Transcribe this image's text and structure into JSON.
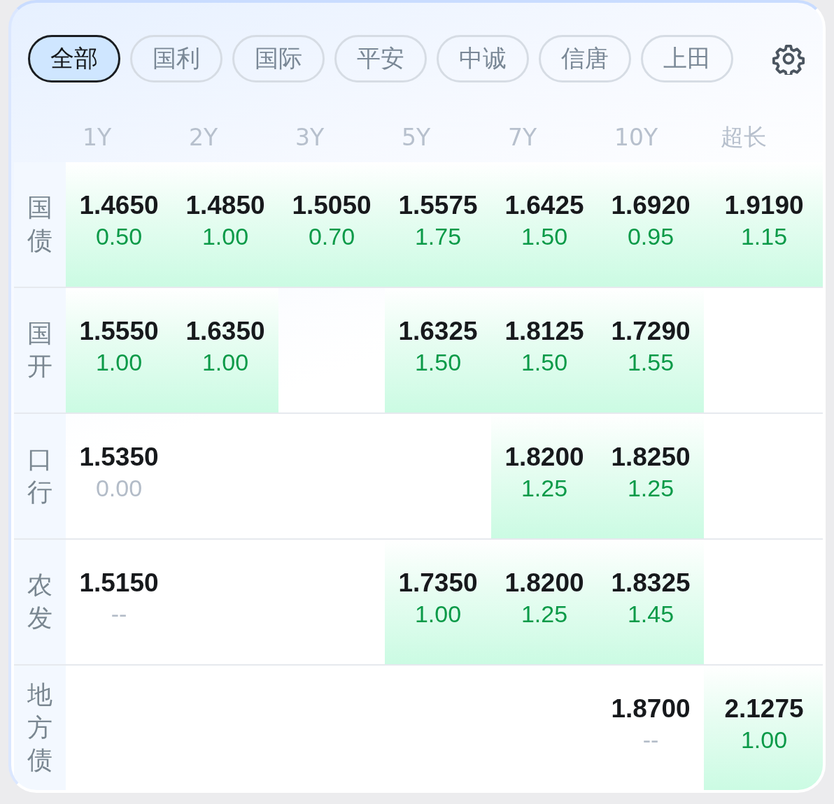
{
  "tabs": [
    {
      "label": "全部",
      "selected": true
    },
    {
      "label": "国利",
      "selected": false
    },
    {
      "label": "国际",
      "selected": false
    },
    {
      "label": "平安",
      "selected": false
    },
    {
      "label": "中诚",
      "selected": false
    },
    {
      "label": "信唐",
      "selected": false
    },
    {
      "label": "上田",
      "selected": false
    }
  ],
  "columns": [
    "1Y",
    "2Y",
    "3Y",
    "5Y",
    "7Y",
    "10Y",
    "超长"
  ],
  "rows": [
    {
      "label": "国债",
      "cells": [
        {
          "rate": "1.4650",
          "change": "0.50",
          "unchanged": false,
          "highlighted": true
        },
        {
          "rate": "1.4850",
          "change": "1.00",
          "unchanged": false,
          "highlighted": true
        },
        {
          "rate": "1.5050",
          "change": "0.70",
          "unchanged": false,
          "highlighted": true
        },
        {
          "rate": "1.5575",
          "change": "1.75",
          "unchanged": false,
          "highlighted": true
        },
        {
          "rate": "1.6425",
          "change": "1.50",
          "unchanged": false,
          "highlighted": true
        },
        {
          "rate": "1.6920",
          "change": "0.95",
          "unchanged": false,
          "highlighted": true
        },
        {
          "rate": "1.9190",
          "change": "1.15",
          "unchanged": false,
          "highlighted": true
        }
      ]
    },
    {
      "label": "国开",
      "cells": [
        {
          "rate": "1.5550",
          "change": "1.00",
          "unchanged": false,
          "highlighted": true
        },
        {
          "rate": "1.6350",
          "change": "1.00",
          "unchanged": false,
          "highlighted": true
        },
        null,
        {
          "rate": "1.6325",
          "change": "1.50",
          "unchanged": false,
          "highlighted": true
        },
        {
          "rate": "1.8125",
          "change": "1.50",
          "unchanged": false,
          "highlighted": true
        },
        {
          "rate": "1.7290",
          "change": "1.55",
          "unchanged": false,
          "highlighted": true
        },
        null
      ]
    },
    {
      "label": "口行",
      "cells": [
        {
          "rate": "1.5350",
          "change": "0.00",
          "unchanged": true,
          "highlighted": false
        },
        null,
        null,
        null,
        {
          "rate": "1.8200",
          "change": "1.25",
          "unchanged": false,
          "highlighted": true
        },
        {
          "rate": "1.8250",
          "change": "1.25",
          "unchanged": false,
          "highlighted": true
        },
        null
      ]
    },
    {
      "label": "农发",
      "cells": [
        {
          "rate": "1.5150",
          "change": "--",
          "unchanged": true,
          "highlighted": false
        },
        null,
        null,
        {
          "rate": "1.7350",
          "change": "1.00",
          "unchanged": false,
          "highlighted": true
        },
        {
          "rate": "1.8200",
          "change": "1.25",
          "unchanged": false,
          "highlighted": true
        },
        {
          "rate": "1.8325",
          "change": "1.45",
          "unchanged": false,
          "highlighted": true
        },
        null
      ]
    },
    {
      "label": "地方债",
      "cells": [
        null,
        null,
        null,
        null,
        null,
        {
          "rate": "1.8700",
          "change": "--",
          "unchanged": true,
          "highlighted": false
        },
        {
          "rate": "2.1275",
          "change": "1.00",
          "unchanged": false,
          "highlighted": true
        }
      ]
    }
  ]
}
